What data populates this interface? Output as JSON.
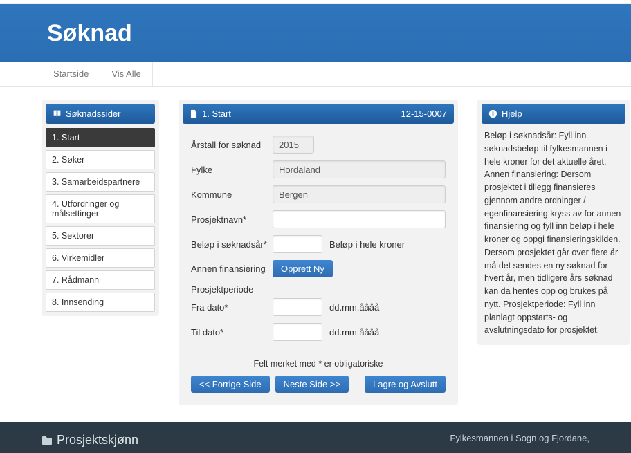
{
  "page": {
    "title": "Søknad"
  },
  "tabs": {
    "home": "Startside",
    "all": "Vis Alle"
  },
  "sidebar": {
    "heading": "Søknadssider",
    "items": [
      "1. Start",
      "2. Søker",
      "3. Samarbeidspartnere",
      "4. Utfordringer og målsettinger",
      "5. Sektorer",
      "6. Virkemidler",
      "7. Rådmann",
      "8. Innsending"
    ]
  },
  "form": {
    "panel_title": "1. Start",
    "case_no": "12-15-0007",
    "labels": {
      "year": "Årstall for søknad",
      "county": "Fylke",
      "municipality": "Kommune",
      "project_name": "Prosjektnavn*",
      "amount": "Beløp i søknadsår*",
      "amount_hint": "Beløp i hele kroner",
      "other_financing": "Annen finansiering",
      "project_period": "Prosjektperiode",
      "from_date": "Fra dato*",
      "to_date": "Til dato*",
      "date_hint": "dd.mm.åååå"
    },
    "values": {
      "year": "2015",
      "county": "Hordaland",
      "municipality": "Bergen",
      "project_name": "",
      "amount": "",
      "from_date": "",
      "to_date": ""
    },
    "buttons": {
      "create_new": "Opprett Ny",
      "prev": "<< Forrige Side",
      "next": "Neste Side >>",
      "save_exit": "Lagre og Avslutt"
    },
    "required_note": "Felt merket med * er obligatoriske"
  },
  "help": {
    "heading": "Hjelp",
    "text": "Beløp i søknadsår: Fyll inn søknadsbeløp til fylkesmannen i hele kroner for det aktuelle året. Annen finansiering: Dersom prosjektet i tillegg finansieres gjennom andre ordninger / egenfinansiering kryss av for annen finansiering og fyll inn beløp i hele kroner og oppgi finansieringskilden. Dersom prosjektet går over flere år må det sendes en ny søknad for hvert år, men tidligere års søknad kan da hentes opp og brukes på nytt. Prosjektperiode: Fyll inn planlagt oppstarts- og avslutningsdato for prosjektet."
  },
  "footer": {
    "brand": "Prosjektskjønn",
    "right": "Fylkesmannen i Sogn og Fjordane,"
  }
}
